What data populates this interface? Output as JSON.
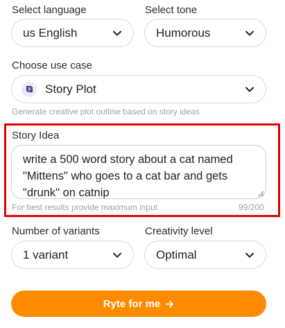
{
  "language": {
    "label": "Select language",
    "value": "us English"
  },
  "tone": {
    "label": "Select tone",
    "value": "Humorous"
  },
  "use_case": {
    "label": "Choose use case",
    "value": "Story Plot",
    "helper": "Generate creative plot outline based on story ideas"
  },
  "story_idea": {
    "label": "Story Idea",
    "value": "write a 500 word story about a cat named \"Mittens\" who goes to a cat bar and gets \"drunk\" on catnip",
    "helper": "For best results provide maximum input",
    "counter": "99/200"
  },
  "variants": {
    "label": "Number of variants",
    "value": "1 variant"
  },
  "creativity": {
    "label": "Creativity level",
    "value": "Optimal"
  },
  "submit": {
    "label": "Ryte for me"
  },
  "colors": {
    "accent": "#ff8a00",
    "highlight_border": "#e00000"
  },
  "icons": {
    "dropdown": "chevron-down-icon",
    "use_case": "story-plot-icon",
    "submit": "arrow-right-icon"
  }
}
